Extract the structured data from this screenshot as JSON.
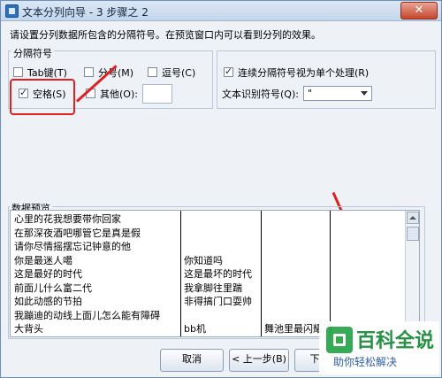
{
  "window": {
    "title": "文本分列向导 - 3 步骤之 2",
    "close_label": "✕"
  },
  "instruction": "请设置分列数据所包含的分隔符号。在预览窗口内可以看到分列的效果。",
  "delimiters": {
    "group_label": "分隔符号",
    "tab": {
      "label": "Tab键(T)",
      "checked": false
    },
    "semicolon": {
      "label": "分号(M)",
      "checked": false
    },
    "comma": {
      "label": "逗号(C)",
      "checked": false
    },
    "space": {
      "label": "空格(S)",
      "checked": true
    },
    "other": {
      "label": "其他(O):",
      "checked": false,
      "value": ""
    }
  },
  "options": {
    "consecutive": {
      "label": "连续分隔符号视为单个处理(R)",
      "checked": true
    },
    "qualifier_label": "文本识别符号(Q):",
    "qualifier_value": "\""
  },
  "preview": {
    "label": "数据预览",
    "rows": [
      [
        "心里的花我想要带你回家",
        "",
        "",
        ""
      ],
      [
        "在那深夜酒吧哪管它是真是假",
        "",
        "",
        ""
      ],
      [
        "请你尽情摇摆忘记钟意的他",
        "",
        "",
        ""
      ],
      [
        "你是最迷人噶",
        "你知道吗",
        "",
        ""
      ],
      [
        "这是最好的时代",
        "这是最坏的时代",
        "",
        ""
      ],
      [
        "前面儿什么富二代",
        "我拿脚往里踹",
        "",
        ""
      ],
      [
        "如此动感的节拍",
        "非得搞门口耍帅",
        "",
        ""
      ],
      [
        "我蹦迪的动线上面儿怎么能有障碍",
        "",
        "",
        ""
      ],
      [
        "大背头",
        "bb机",
        "舞池里最闪耀的",
        ""
      ]
    ]
  },
  "buttons": {
    "cancel": "取消",
    "back": "< 上一步(B)",
    "next": "下一步"
  },
  "watermark": {
    "title": "百科全说",
    "subtitle": "助你轻松解决"
  },
  "colors": {
    "annotation": "#e02020",
    "watermark_green": "#1f8f3d"
  }
}
